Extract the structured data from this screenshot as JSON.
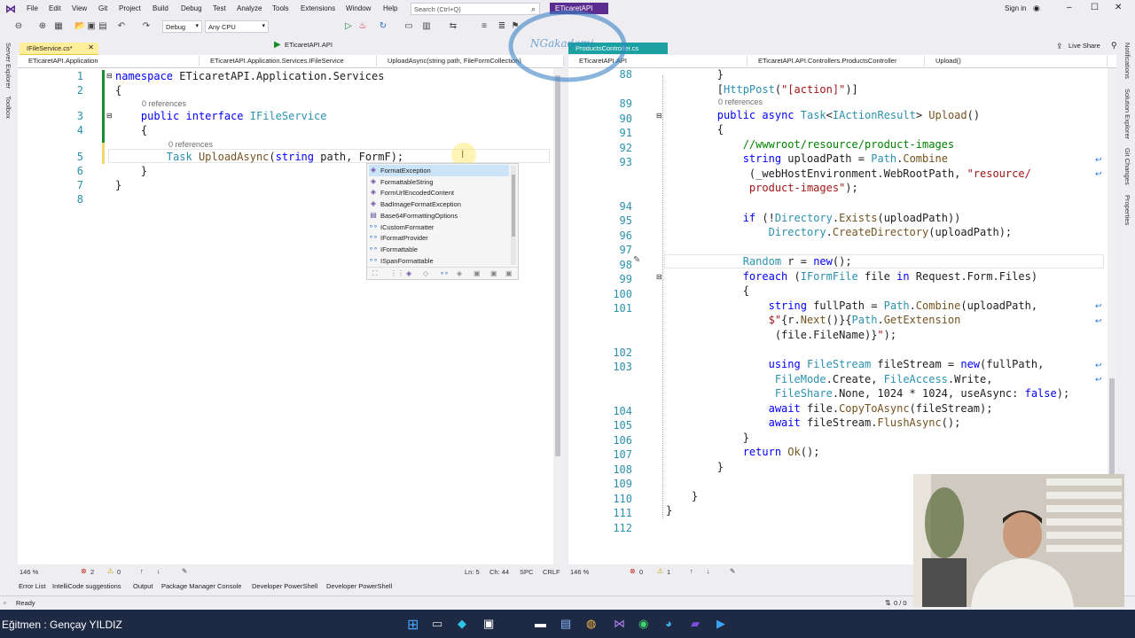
{
  "menu": {
    "items": [
      "File",
      "Edit",
      "View",
      "Git",
      "Project",
      "Build",
      "Debug",
      "Test",
      "Analyze",
      "Tools",
      "Extensions",
      "Window",
      "Help"
    ],
    "search_placeholder": "Search (Ctrl+Q)",
    "project_name": "ETicaretAPI",
    "sign_in": "Sign in",
    "live_share": "Live Share"
  },
  "toolbar": {
    "config": "Debug",
    "platform": "Any CPU",
    "run_target": "ETicaretAPI.API"
  },
  "side": {
    "server_explorer": "Server Explorer",
    "toolbox": "Toolbox",
    "notifications": "Notifications",
    "solution_explorer": "Solution Explorer",
    "git_changes": "Git Changes",
    "properties": "Properties"
  },
  "left_editor": {
    "tab": "IFileService.cs*",
    "nav_project": "ETicaretAPI.Application",
    "nav_type": "ETicaretAPI.Application.Services.IFileService",
    "nav_member": "UploadAsync(string path, FileFormCollection)",
    "line_numbers": [
      "1",
      "2",
      "3",
      "4",
      "5",
      "6",
      "7",
      "8"
    ],
    "refs_a": "0 references",
    "refs_b": "0 references",
    "zoom": "146 %",
    "errors": "2",
    "warnings": "0",
    "pos_ln": "Ln: 5",
    "pos_ch": "Ch: 44",
    "spc": "SPC",
    "crlf": "CRLF"
  },
  "intellisense": {
    "items": [
      "FormatException",
      "FormattableString",
      "FormUrlEncodedContent",
      "BadImageFormatException",
      "Base64FormattingOptions",
      "ICustomFormatter",
      "IFormatProvider",
      "IFormattable",
      "ISpanFormattable"
    ]
  },
  "right_editor": {
    "tab": "ProductsController.cs",
    "nav_project": "ETicaretAPI.API",
    "nav_type": "ETicaretAPI.API.Controllers.ProductsController",
    "nav_member": "Upload()",
    "line_numbers": [
      "88",
      "",
      "89",
      "90",
      "91",
      "92",
      "93",
      "",
      "",
      "94",
      "95",
      "96",
      "97",
      "98",
      "99",
      "100",
      "101",
      "",
      "",
      "102",
      "103",
      "",
      "",
      "104",
      "105",
      "106",
      "107",
      "108",
      "109",
      "110",
      "111",
      "112"
    ],
    "refs": "0 references",
    "zoom": "146 %",
    "errors": "0",
    "warnings": "1"
  },
  "bottom_tabs": [
    "Error List",
    "IntelliCode suggestions",
    "Output",
    "Package Manager Console",
    "Developer PowerShell",
    "Developer PowerShell"
  ],
  "status": {
    "ready": "Ready",
    "git": "0 / 0"
  },
  "overlay": {
    "instructor": "Eğitmen : Gençay YILDIZ",
    "watermark": "NGakademi"
  }
}
